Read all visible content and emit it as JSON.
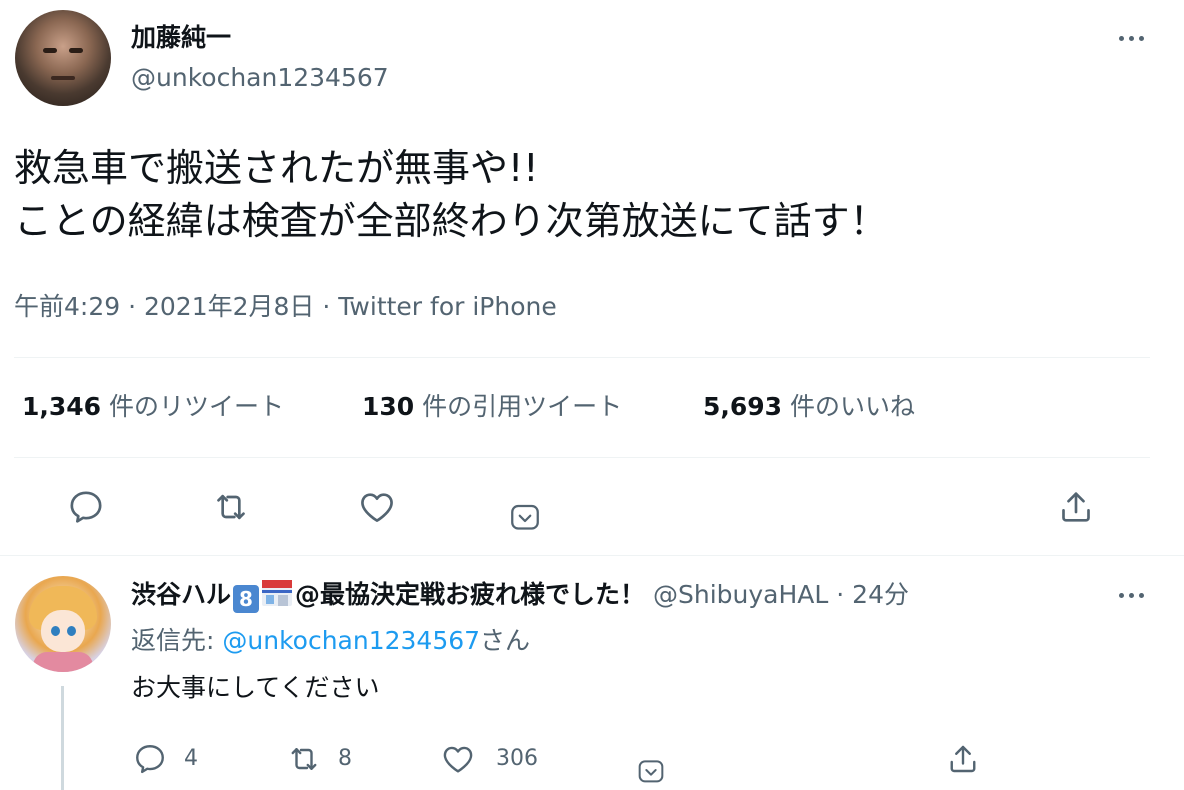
{
  "tweet": {
    "author": {
      "display_name": "加藤純一",
      "handle": "@unkochan1234567"
    },
    "text_lines": [
      "救急車で搬送されたが無事や!!",
      "ことの経緯は検査が全部終わり次第放送にて話す！"
    ],
    "time": "午前4:29",
    "date": "2021年2月8日",
    "separator": "·",
    "source": "Twitter for iPhone",
    "stats": {
      "retweets": {
        "count": "1,346",
        "label": "件のリツイート"
      },
      "quotes": {
        "count": "130",
        "label": "件の引用ツイート"
      },
      "likes": {
        "count": "5,693",
        "label": "件のいいね"
      }
    }
  },
  "reply": {
    "author": {
      "display_name_prefix": "渋谷ハル",
      "badge": "8",
      "display_name_suffix": "@最協決定戦お疲れ様でした！",
      "handle": "@ShibuyaHAL"
    },
    "separator": "·",
    "time": "24分",
    "replying_label": "返信先: ",
    "replying_to": "@unkochan1234567",
    "replying_suffix": "さん",
    "text": "お大事にしてください",
    "counts": {
      "replies": "4",
      "retweets": "8",
      "likes": "306"
    }
  },
  "colors": {
    "text": "#0f1419",
    "secondary": "#536471",
    "link": "#1d9bf0",
    "divider": "#eff3f4"
  },
  "icons": [
    "more-icon",
    "reply-icon",
    "retweet-icon",
    "like-icon",
    "tip-icon",
    "share-icon"
  ]
}
